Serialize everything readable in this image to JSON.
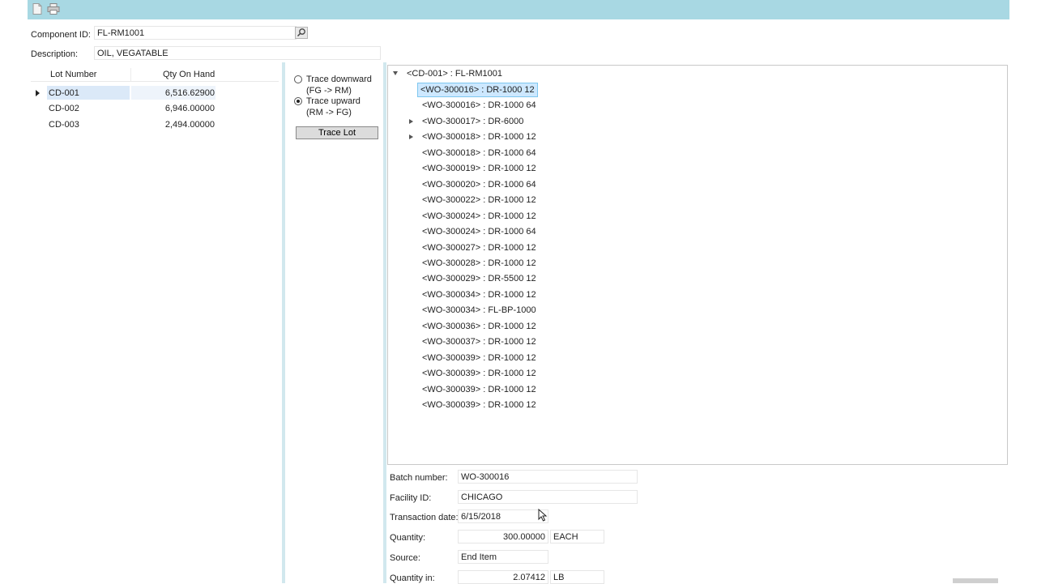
{
  "toolbar": {
    "icons": [
      "new-document-icon",
      "print-icon"
    ]
  },
  "component": {
    "id_label": "Component ID:",
    "id_value": "FL-RM1001",
    "desc_label": "Description:",
    "desc_value": "OIL, VEGATABLE"
  },
  "lots": {
    "headers": {
      "lot": "Lot Number",
      "qty": "Qty On Hand"
    },
    "rows": [
      {
        "lot": "CD-001",
        "qty": "6,516.62900"
      },
      {
        "lot": "CD-002",
        "qty": "6,946.00000"
      },
      {
        "lot": "CD-003",
        "qty": "2,494.00000"
      }
    ]
  },
  "trace": {
    "down_line1": "Trace downward",
    "down_line2": "(FG -> RM)",
    "up_line1": "Trace upward",
    "up_line2": "(RM -> FG)",
    "selected": "upward",
    "button": "Trace Lot"
  },
  "tree": {
    "root": "<CD-001> : FL-RM1001",
    "nodes": [
      {
        "text": "<WO-300016> : DR-1000 12",
        "expandable": false,
        "selected": true
      },
      {
        "text": "<WO-300016> : DR-1000 64",
        "expandable": false
      },
      {
        "text": "<WO-300017> : DR-6000",
        "expandable": true
      },
      {
        "text": "<WO-300018> : DR-1000 12",
        "expandable": true
      },
      {
        "text": "<WO-300018> : DR-1000 64",
        "expandable": false
      },
      {
        "text": "<WO-300019> : DR-1000 12",
        "expandable": false
      },
      {
        "text": "<WO-300020> : DR-1000 64",
        "expandable": false
      },
      {
        "text": "<WO-300022> : DR-1000 12",
        "expandable": false
      },
      {
        "text": "<WO-300024> : DR-1000 12",
        "expandable": false
      },
      {
        "text": "<WO-300024> : DR-1000 64",
        "expandable": false
      },
      {
        "text": "<WO-300027> : DR-1000 12",
        "expandable": false
      },
      {
        "text": "<WO-300028> : DR-1000 12",
        "expandable": false
      },
      {
        "text": "<WO-300029> : DR-5500 12",
        "expandable": false
      },
      {
        "text": "<WO-300034> : DR-1000 12",
        "expandable": false
      },
      {
        "text": "<WO-300034> : FL-BP-1000",
        "expandable": false
      },
      {
        "text": "<WO-300036> : DR-1000 12",
        "expandable": false
      },
      {
        "text": "<WO-300037> : DR-1000 12",
        "expandable": false
      },
      {
        "text": "<WO-300039> : DR-1000 12",
        "expandable": false
      },
      {
        "text": "<WO-300039> : DR-1000 12",
        "expandable": false
      },
      {
        "text": "<WO-300039> : DR-1000 12",
        "expandable": false
      },
      {
        "text": "<WO-300039> : DR-1000 12",
        "expandable": false
      }
    ]
  },
  "details": {
    "batch_label": "Batch number:",
    "batch_value": "WO-300016",
    "facility_label": "Facility ID:",
    "facility_value": "CHICAGO",
    "date_label": "Transaction date:",
    "date_value": "6/15/2018",
    "qty_label": "Quantity:",
    "qty_value": "300.00000",
    "qty_uom": "EACH",
    "source_label": "Source:",
    "source_value": "End Item",
    "qtyin_label": "Quantity in:",
    "qtyin_value": "2.07412",
    "qtyin_uom": "LB"
  }
}
